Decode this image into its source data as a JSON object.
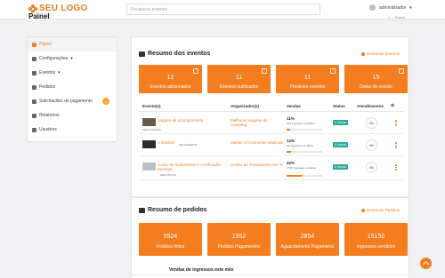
{
  "header": {
    "logo_text": "SEU LOGO",
    "search_placeholder": "Pesquisar eventos",
    "user_name": "administrador",
    "page_title": "Painel",
    "breadcrumb_current": "Painel"
  },
  "sidebar": {
    "items": [
      {
        "label": "Painel",
        "icon": "dashboard-icon",
        "active": true
      },
      {
        "label": "Configurações",
        "icon": "gear-icon",
        "caret": true
      },
      {
        "label": "Eventos",
        "icon": "calendar-icon",
        "caret": true
      },
      {
        "label": "Pedidos",
        "icon": "cart-icon"
      },
      {
        "label": "Solicitações de pagamento",
        "icon": "money-icon",
        "badge": "0"
      },
      {
        "label": "Relatórios",
        "icon": "report-icon"
      },
      {
        "label": "Usuários",
        "icon": "users-icon"
      }
    ]
  },
  "events": {
    "title": "Resumo dos eventos",
    "manage_label": "Gerenciar Eventos",
    "tiles": [
      {
        "value": "12",
        "label": "Eventos adicionados"
      },
      {
        "value": "11",
        "label": "Eventos publicados"
      },
      {
        "value": "11",
        "label": "Próximos eventos"
      },
      {
        "value": "15",
        "label": "Datas do evento"
      }
    ],
    "columns": [
      "Evento(s)",
      "Organizador(a)",
      "Vendas",
      "Status",
      "Atendimentos",
      ""
    ],
    "rows": [
      {
        "name": "Viagem de acampamento",
        "code": "#E647A9de4ba",
        "organizer": "Melhores viagens de Camping",
        "sales_pct": "11%",
        "sales_text": "100 Ingressos vendidos",
        "fill": 0.11,
        "status": "A Venda",
        "attendance": "0%"
      },
      {
        "name": "A história",
        "code": "#E279aa8d945",
        "organizer": "Master of Concertos Musicais",
        "sales_pct": "12%",
        "sales_text": "10 Ingressos vendidos",
        "fill": 0.12,
        "status": "A Venda",
        "attendance": "0%"
      },
      {
        "name": "Curso de treinamento e certificação DevOps",
        "code": "#E0e7f9e749",
        "organizer": "Centro de Treinamento em TI",
        "sales_pct": "42%",
        "sales_text": "2711 Ingressos vendidos",
        "fill": 0.42,
        "status": "A Venda",
        "attendance": "0%"
      }
    ]
  },
  "orders": {
    "title": "Resumo de pedidos",
    "manage_label": "Gerenciar Pedidos",
    "tiles": [
      {
        "value": "5524",
        "label": "Pedidos feitos"
      },
      {
        "value": "1952",
        "label": "Pedidos Pagamentos"
      },
      {
        "value": "2854",
        "label": "Aguardamento Pagamento"
      },
      {
        "value": "15150",
        "label": "Ingressos vendidos"
      }
    ],
    "chart_title": "Vendas de ingressos este mês"
  },
  "colors": {
    "accent": "#f47d1f",
    "status_green": "#2aa89a"
  }
}
